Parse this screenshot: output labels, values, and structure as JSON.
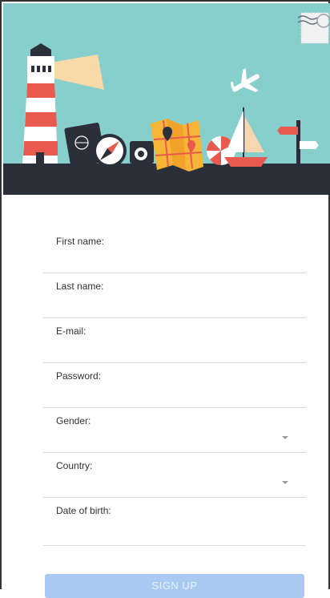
{
  "form": {
    "fields": [
      {
        "label": "First name:"
      },
      {
        "label": "Last name:"
      },
      {
        "label": "E-mail:"
      },
      {
        "label": "Password:"
      },
      {
        "label": "Gender:"
      },
      {
        "label": "Country:"
      },
      {
        "label": "Date of birth:"
      }
    ],
    "submit_label": "SIGN UP"
  },
  "colors": {
    "hero_sky": "#86cfcc",
    "ground": "#2b2f3a",
    "button": "#a9c8f2",
    "divider": "#d9d9d9"
  },
  "icons": [
    "lighthouse-icon",
    "passport-icon",
    "compass-icon",
    "camera-icon",
    "map-icon",
    "beach-ball-icon",
    "sailboat-icon",
    "airplane-icon",
    "signpost-icon",
    "postage-stamp-icon",
    "dropdown-caret-icon"
  ]
}
